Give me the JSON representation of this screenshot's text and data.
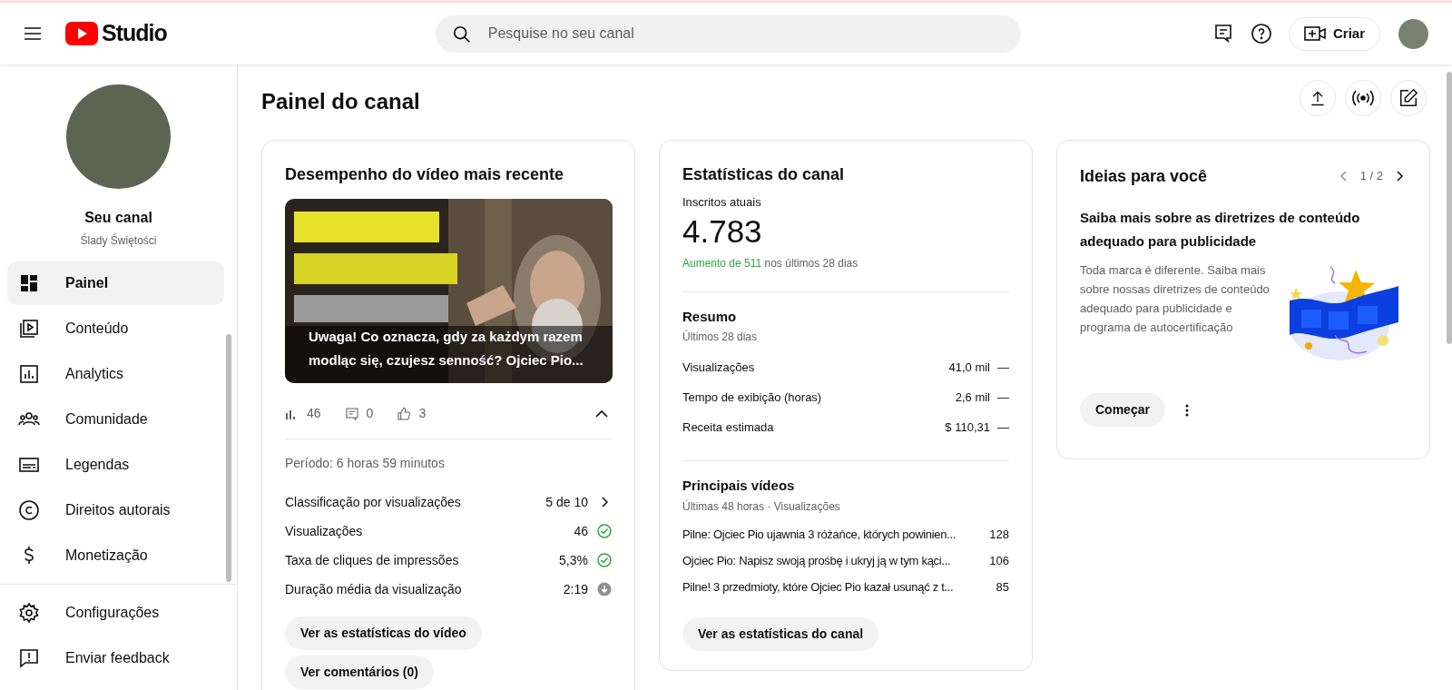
{
  "header": {
    "logo_text": "Studio",
    "search": {
      "placeholder": "Pesquise no seu canal"
    },
    "create_button": "Criar"
  },
  "sidebar": {
    "channel_label": "Seu canal",
    "channel_name": "Ślady Świętości",
    "items": [
      {
        "label": "Painel",
        "selected": true
      },
      {
        "label": "Conteúdo",
        "selected": false
      },
      {
        "label": "Analytics",
        "selected": false
      },
      {
        "label": "Comunidade",
        "selected": false
      },
      {
        "label": "Legendas",
        "selected": false
      },
      {
        "label": "Direitos autorais",
        "selected": false
      },
      {
        "label": "Monetização",
        "selected": false
      }
    ],
    "footer_items": [
      "Configurações",
      "Enviar feedback"
    ]
  },
  "page_title": "Painel do canal",
  "latest_video": {
    "title": "Desempenho do vídeo mais recente",
    "thumbnail": {
      "kind": "picture",
      "caption": "Uwaga! Co oznacza, gdy za każdym razem modląc się, czujesz senność? Ojciec Pio..."
    },
    "counts": {
      "views": "46",
      "comments": "0",
      "likes": "3"
    },
    "expanded": true,
    "period": "Período: 6 horas 59 minutos",
    "metrics": [
      {
        "label": "Classificação por visualizações",
        "value": "5 de 10",
        "kind": "link"
      },
      {
        "label": "Visualizações",
        "value": "46",
        "kind": "good"
      },
      {
        "label": "Taxa de cliques de impressões",
        "value": "5,3%",
        "kind": "good"
      },
      {
        "label": "Duração média da visualização",
        "value": "2:19",
        "kind": "below"
      }
    ],
    "buttons": [
      "Ver as estatísticas do vídeo",
      "Ver comentários (0)"
    ]
  },
  "channel_stats": {
    "title": "Estatísticas do canal",
    "subscribers_label": "Inscritos atuais",
    "subscribers": "4.783",
    "change_highlight": "Aumento de 511",
    "change_rest": "nos últimos 28 dias",
    "summary": {
      "title": "Resumo",
      "subtitle": "Últimos 28 dias",
      "rows": [
        {
          "label": "Visualizações",
          "value": "41,0 mil",
          "trend": "—"
        },
        {
          "label": "Tempo de exibição (horas)",
          "value": "2,6 mil",
          "trend": "—"
        },
        {
          "label": "Receita estimada",
          "value": "$ 110,31",
          "trend": "—"
        }
      ]
    },
    "top_videos": {
      "title": "Principais vídeos",
      "subtitle": "Últimas 48 horas · Visualizações",
      "rows": [
        {
          "title": "Pilne: Ojciec Pio ujawnia 3 różańce, których powinien...",
          "views": "128"
        },
        {
          "title": "Ojciec Pio: Napisz swoją prośbę i ukryj ją w tym kąci...",
          "views": "106"
        },
        {
          "title": "Pilne! 3 przedmioty, które Ojciec Pio kazał usunąć z t...",
          "views": "85"
        }
      ]
    },
    "button": "Ver as estatísticas do canal"
  },
  "ideas": {
    "title": "Ideias para você",
    "pager": "1 / 2",
    "heading": "Saiba mais sobre as diretrizes de conteúdo adequado para publicidade",
    "body": "Toda marca é diferente. Saiba mais sobre nossas diretrizes de conteúdo adequado para publicidade e programa de autocertificação",
    "button": "Começar"
  }
}
